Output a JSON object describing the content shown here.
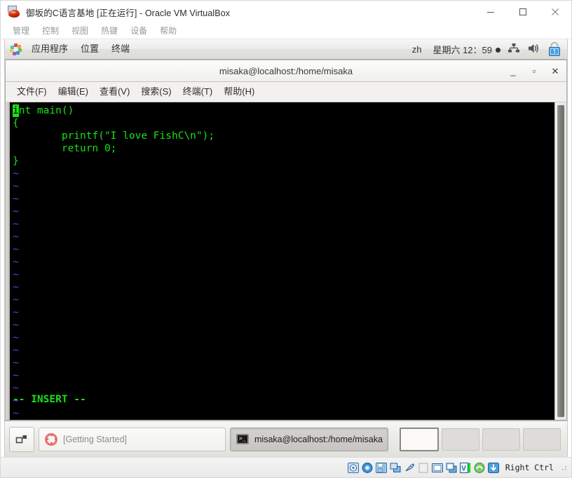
{
  "host_window": {
    "title": "御坂的C语言基地 [正在运行] - Oracle VM VirtualBox",
    "icon": "virtualbox-vm-icon",
    "controls": {
      "minimize": "minimize-icon",
      "maximize": "maximize-icon",
      "close": "close-icon"
    },
    "menu": [
      {
        "label": "管理"
      },
      {
        "label": "控制"
      },
      {
        "label": "视图"
      },
      {
        "label": "热键"
      },
      {
        "label": "设备"
      },
      {
        "label": "帮助"
      }
    ]
  },
  "guest_panel": {
    "apps_icon": "gnome-applications-icon",
    "items": [
      {
        "label": "应用程序"
      },
      {
        "label": "位置"
      },
      {
        "label": "终端"
      }
    ],
    "language": "zh",
    "clock": "星期六 12：59",
    "tray": [
      {
        "name": "network-icon"
      },
      {
        "name": "volume-icon"
      },
      {
        "name": "software-update-lock-icon"
      }
    ]
  },
  "terminal": {
    "title": "misaka@localhost:/home/misaka",
    "controls": {
      "minimize": "_",
      "maximize": "▫",
      "close": "✕"
    },
    "menu": [
      {
        "label": "文件(F)"
      },
      {
        "label": "编辑(E)"
      },
      {
        "label": "查看(V)"
      },
      {
        "label": "搜索(S)"
      },
      {
        "label": "终端(T)"
      },
      {
        "label": "帮助(H)"
      }
    ],
    "editor": {
      "cursor_char": "i",
      "lines": [
        "nt main()",
        "{",
        "        printf(\"I love FishC\\n\");",
        "        return 0;",
        "}"
      ],
      "tilde_count": 20,
      "tilde_char": "~",
      "status": "-- INSERT --"
    },
    "colors": {
      "foreground": "#18e018",
      "background": "#000000",
      "tilde": "#4a4ae8"
    }
  },
  "taskbar": {
    "show_desktop": "show-desktop-button",
    "windows": [
      {
        "label": "[Getting Started]",
        "icon": "lifebuoy-icon",
        "active": false
      },
      {
        "label": "misaka@localhost:/home/misaka",
        "icon": "terminal-icon",
        "active": true
      }
    ],
    "workspaces": [
      {
        "name": "workspace-1",
        "active": true
      },
      {
        "name": "workspace-2",
        "active": false
      },
      {
        "name": "workspace-3",
        "active": false
      },
      {
        "name": "workspace-4",
        "active": false
      }
    ]
  },
  "status_bar": {
    "icons": [
      {
        "name": "hard-disk-icon"
      },
      {
        "name": "optical-disk-icon"
      },
      {
        "name": "floppy-disk-icon"
      },
      {
        "name": "network-adapter-icon"
      },
      {
        "name": "usb-icon"
      },
      {
        "name": "shared-folders-icon"
      },
      {
        "name": "display-icon"
      },
      {
        "name": "video-capture-icon"
      },
      {
        "name": "virtualization-icon"
      },
      {
        "name": "mouse-integration-icon"
      },
      {
        "name": "host-key-icon"
      }
    ],
    "host_key": "Right Ctrl"
  }
}
